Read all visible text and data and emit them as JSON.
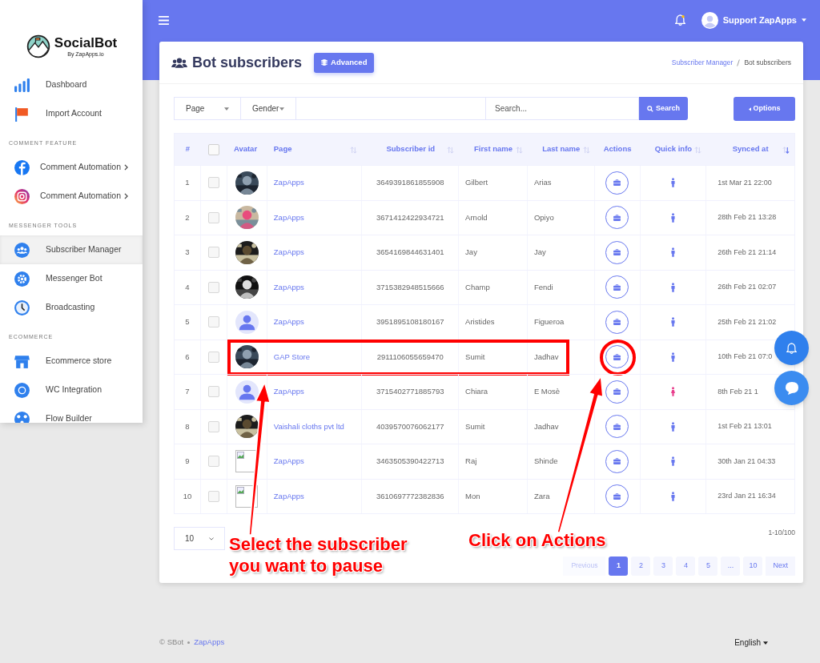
{
  "sidebar": {
    "logo": {
      "name": "SocialBot",
      "tagline": "By ZapApps.io"
    },
    "sections": [
      {
        "items": [
          {
            "label": "Dashboard",
            "selected": false,
            "submenu": false
          },
          {
            "label": "Import Account",
            "selected": false,
            "submenu": false
          }
        ]
      },
      {
        "title": "COMMENT FEATURE",
        "items": [
          {
            "label": "Comment Automation",
            "selected": false,
            "submenu": true
          },
          {
            "label": "Comment Automation",
            "selected": false,
            "submenu": true
          }
        ]
      },
      {
        "title": "MESSENGER TOOLS",
        "items": [
          {
            "label": "Subscriber Manager",
            "selected": true,
            "submenu": false
          },
          {
            "label": "Messenger Bot",
            "selected": false,
            "submenu": false
          },
          {
            "label": "Broadcasting",
            "selected": false,
            "submenu": false
          }
        ]
      },
      {
        "title": "ECOMMERCE",
        "items": [
          {
            "label": "Ecommerce store",
            "selected": false,
            "submenu": false
          },
          {
            "label": "WC Integration",
            "selected": false,
            "submenu": false
          },
          {
            "label": "Flow Builder",
            "selected": false,
            "submenu": false
          }
        ]
      }
    ]
  },
  "topbar": {
    "user": "Support ZapApps"
  },
  "header": {
    "title": "Bot subscribers",
    "advanced_button": "Advanced",
    "breadcrumb": [
      "Subscriber Manager",
      "Bot subscribers"
    ]
  },
  "filters": {
    "page": "Page",
    "gender": "Gender",
    "search_placeholder": "Search...",
    "search_button": "Search",
    "options_button": "Options"
  },
  "table": {
    "columns": [
      {
        "label": "#",
        "sortable": false
      },
      {
        "kind": "checkbox",
        "checked": false,
        "sortable": false
      },
      {
        "label": "Avatar",
        "sortable": false
      },
      {
        "label": "Page",
        "sortable": true,
        "sorted": false
      },
      {
        "label": "Subscriber id",
        "sortable": true,
        "sorted": false
      },
      {
        "label": "First name",
        "sortable": true,
        "sorted": false
      },
      {
        "label": "Last name",
        "sortable": true,
        "sorted": false
      },
      {
        "label": "Actions",
        "sortable": false
      },
      {
        "label": "Quick info",
        "sortable": true,
        "sorted": false
      },
      {
        "label": "Synced at",
        "sortable": true,
        "sorted": true
      }
    ],
    "rows": [
      {
        "num": "1",
        "checked": false,
        "page": "ZapApps",
        "subscriber_id": "3649391861855908",
        "first_name": "Gilbert",
        "last_name": "Arias",
        "female": false,
        "synced_at": "1st Mar 21 22:00",
        "highlighted": false
      },
      {
        "num": "2",
        "checked": false,
        "page": "ZapApps",
        "subscriber_id": "3671412422934721",
        "first_name": "Arnold",
        "last_name": "Opiyo",
        "female": false,
        "synced_at": "28th Feb 21 13:28",
        "highlighted": false
      },
      {
        "num": "3",
        "checked": false,
        "page": "ZapApps",
        "subscriber_id": "3654169844631401",
        "first_name": "Jay",
        "last_name": "Jay",
        "female": false,
        "synced_at": "26th Feb 21 21:14",
        "highlighted": false
      },
      {
        "num": "4",
        "checked": false,
        "page": "ZapApps",
        "subscriber_id": "3715382948515666",
        "first_name": "Champ",
        "last_name": "Fendi",
        "female": false,
        "synced_at": "26th Feb 21 02:07",
        "highlighted": false
      },
      {
        "num": "5",
        "checked": false,
        "avatar": {
          "kind": "placeholder"
        },
        "page": "ZapApps",
        "subscriber_id": "3951895108180167",
        "first_name": "Aristides",
        "last_name": "Figueroa",
        "female": false,
        "synced_at": "25th Feb 21 21:02",
        "highlighted": false
      },
      {
        "num": "6",
        "checked": false,
        "page": "GAP Store",
        "subscriber_id": "2911106055659470",
        "first_name": "Sumit",
        "last_name": "Jadhav",
        "female": false,
        "synced_at": "10th Feb 21 07:0",
        "highlighted": true
      },
      {
        "num": "7",
        "checked": false,
        "avatar": {
          "kind": "placeholder"
        },
        "page": "ZapApps",
        "subscriber_id": "3715402771885793",
        "first_name": "Chiara",
        "last_name": "E Mosè",
        "female": true,
        "synced_at": "8th Feb 21 1",
        "highlighted": false
      },
      {
        "num": "8",
        "checked": false,
        "page": "Vaishali cloths pvt ltd",
        "subscriber_id": "4039570076062177",
        "first_name": "Sumit",
        "last_name": "Jadhav",
        "female": false,
        "synced_at": "1st Feb 21 13:01",
        "highlighted": false
      },
      {
        "num": "9",
        "checked": false,
        "avatar": {
          "kind": "broken"
        },
        "page": "ZapApps",
        "subscriber_id": "3463505390422713",
        "first_name": "Raj",
        "last_name": "Shinde",
        "female": false,
        "synced_at": "30th Jan 21 04:33",
        "highlighted": false
      },
      {
        "num": "10",
        "checked": false,
        "avatar": {
          "kind": "broken"
        },
        "page": "ZapApps",
        "subscriber_id": "3610697772382836",
        "first_name": "Mon",
        "last_name": "Zara",
        "female": false,
        "synced_at": "23rd Jan 21 16:34",
        "highlighted": false
      }
    ]
  },
  "page_length": "10",
  "range": "1-10/100",
  "pagination": {
    "previous": "Previous",
    "previous_disabled": true,
    "pages": [
      {
        "label": "1",
        "selected": true
      },
      {
        "label": "2",
        "selected": false
      },
      {
        "label": "3",
        "selected": false
      },
      {
        "label": "4",
        "selected": false
      },
      {
        "label": "5",
        "selected": false
      },
      {
        "label": "...",
        "selected": false
      },
      {
        "label": "10",
        "selected": false
      }
    ],
    "next": "Next"
  },
  "footer": {
    "copyright": "© SBot",
    "link": "ZapApps",
    "language": "English"
  },
  "callouts": [
    "Select the subscriber you want to pause",
    "Click on Actions"
  ]
}
